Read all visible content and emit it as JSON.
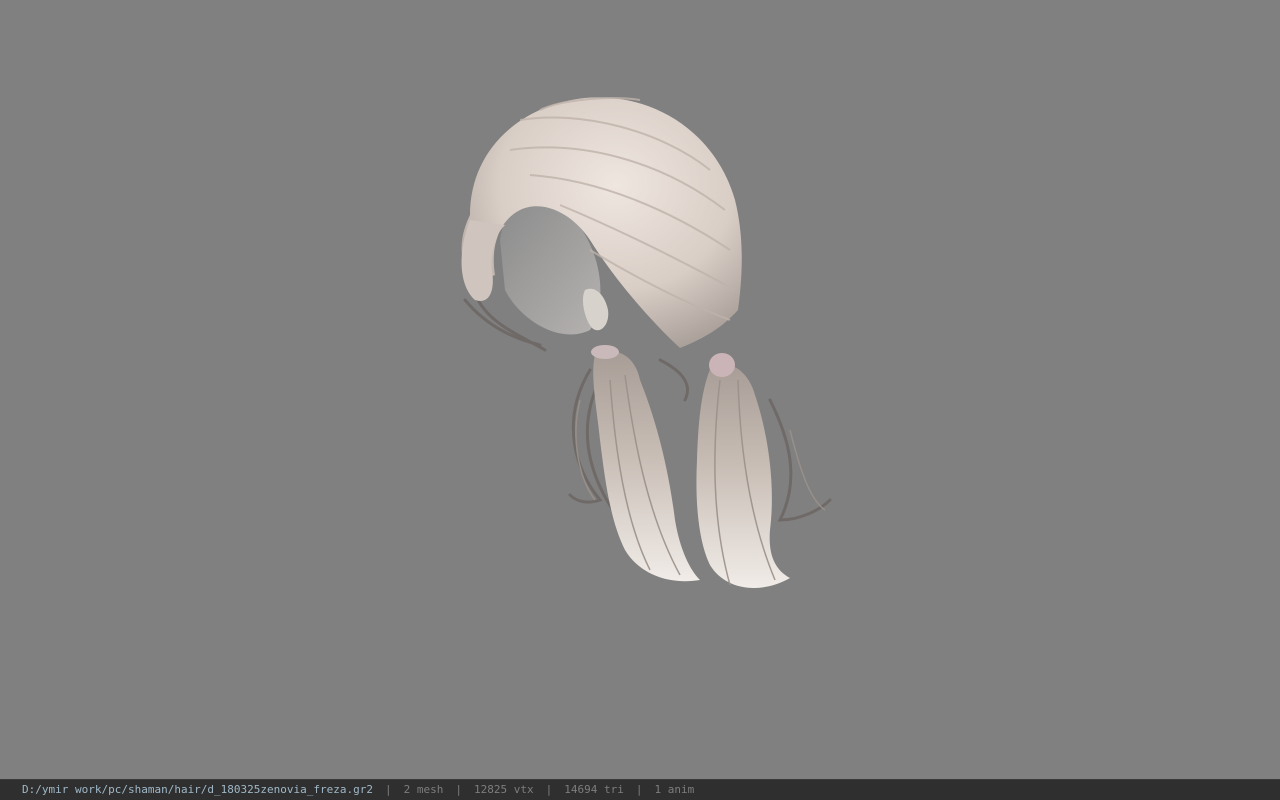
{
  "viewport": {
    "background_color": "#808080",
    "model_description_icon": "hair-model-icon"
  },
  "status_bar": {
    "file_path": "D:/ymir work/pc/shaman/hair/d_180325zenovia_freza.gr2",
    "separator": "|",
    "mesh": "2 mesh",
    "vtx": "12825 vtx",
    "tri": "14694 tri",
    "anim": "1 anim",
    "path_color": "#9fb8c8",
    "stat_color": "#7d7d7d",
    "background_color": "#2f2f2f"
  }
}
